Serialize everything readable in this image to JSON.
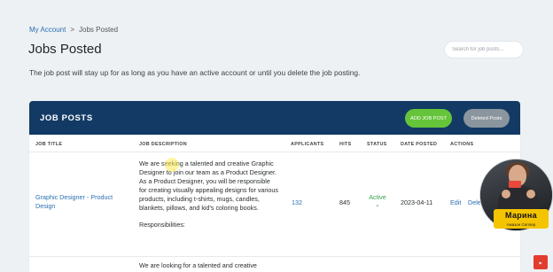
{
  "breadcrumb": {
    "home": "My Account",
    "sep": ">",
    "current": "Jobs Posted"
  },
  "page": {
    "title": "Jobs Posted",
    "subtitle": "The job post will stay up for as long as you have an active account or until you delete the job posting."
  },
  "search": {
    "placeholder": "Search for job posts..."
  },
  "panel": {
    "title": "JOB POSTS",
    "add_label": "ADD JOB POST",
    "deleted_label": "Deleted Posts"
  },
  "table": {
    "headers": {
      "job_title": "JOB TITLE",
      "job_description": "JOB DESCRIPTION",
      "applicants": "APPLICANTS",
      "hits": "HITS",
      "status": "STATUS",
      "date_posted": "DATE POSTED",
      "actions": "ACTIONS"
    },
    "rows": [
      {
        "title": "Graphic Designer - Product Design",
        "description_p1": "We are seeking a talented and creative Graphic Designer to join our team as a Product Designer. As a Product Designer, you will be responsible for creating visually appealing designs for various products, including t-shirts, mugs, candles, blankets, pillows, and kid's coloring books.",
        "description_p2": "Responsibilities:",
        "applicants": "132",
        "hits": "845",
        "status": "Active",
        "status_caret": "⌄",
        "date": "2023-04-11",
        "edit": "Edit",
        "delete": "Delete"
      },
      {
        "description_p1": "We are looking for a talented and creative"
      }
    ]
  },
  "webcam": {
    "name": "Марина",
    "role": "Амазон Селлер"
  },
  "colors": {
    "header": "#123a64",
    "add": "#66c43a",
    "deleted": "#8a959e",
    "link": "#2b6fb0",
    "active": "#3aa04b",
    "badge": "#f5c400"
  }
}
